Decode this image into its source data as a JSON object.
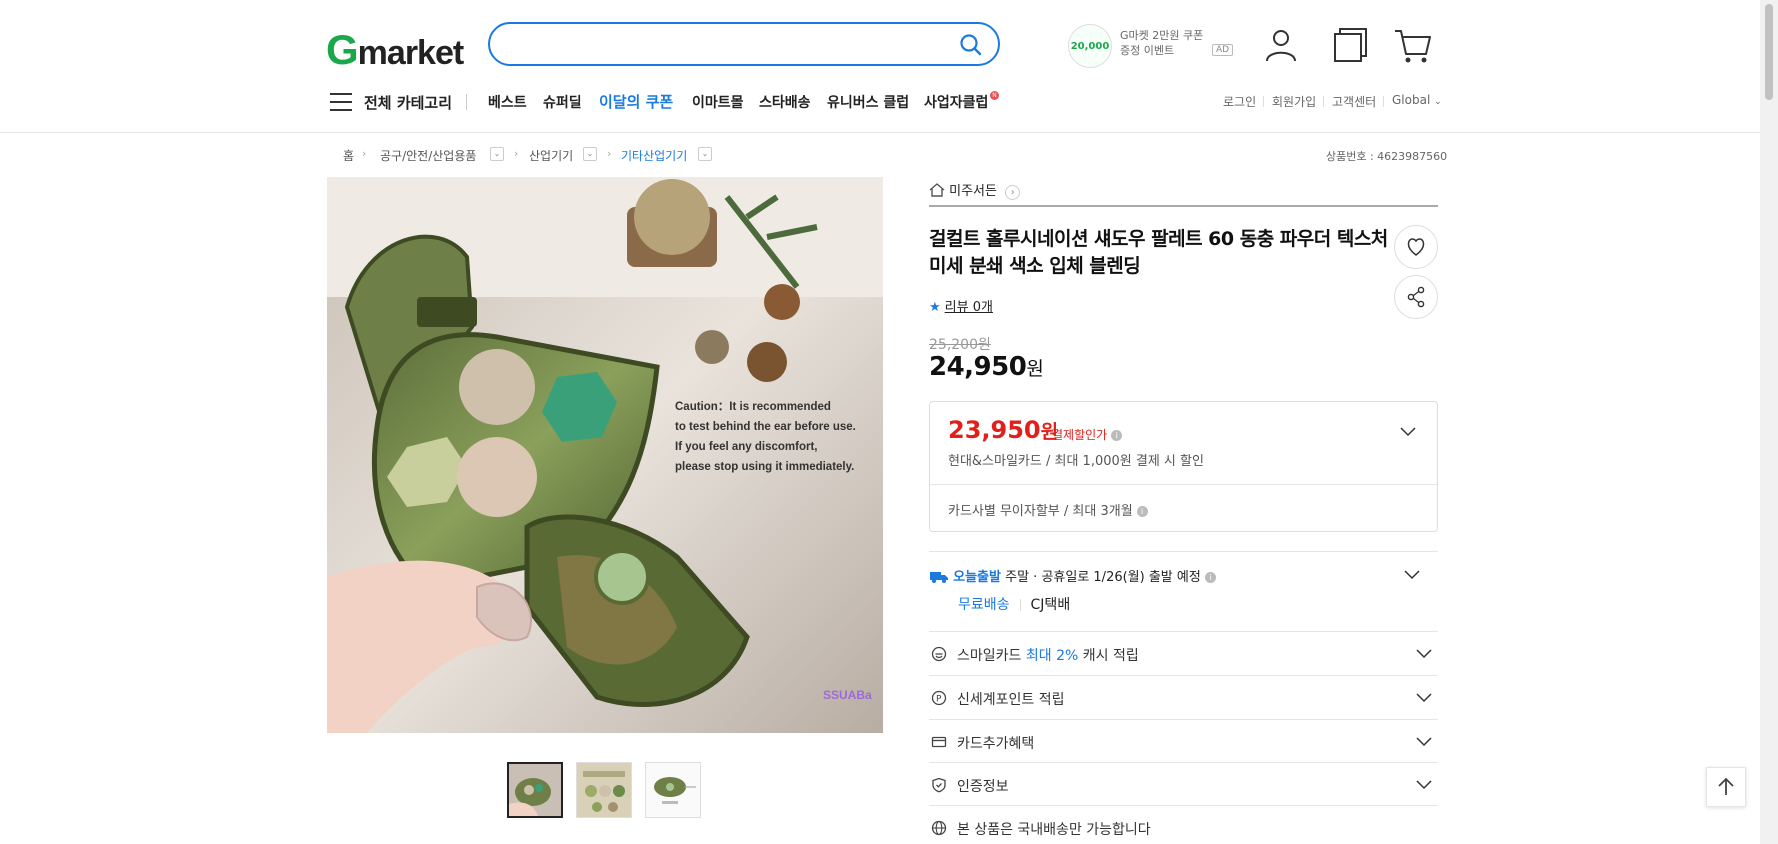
{
  "header": {
    "logo_g": "G",
    "logo_rest": "market",
    "search_placeholder": "",
    "ad": {
      "amount": "20,000",
      "line1": "G마켓 2만원 쿠폰",
      "line2": "증정 이벤트",
      "badge": "AD"
    }
  },
  "nav": {
    "all_categories": "전체 카테고리",
    "items": [
      "베스트",
      "슈퍼딜",
      "이달의 쿠폰",
      "이마트몰",
      "스타배송",
      "유니버스 클럽",
      "사업자클럽"
    ],
    "new_badge": "N",
    "utility": [
      "로그인",
      "회원가입",
      "고객센터",
      "Global"
    ]
  },
  "breadcrumb": {
    "home": "홈",
    "items": [
      "공구/안전/산업용품",
      "산업기기",
      "기타산업기기"
    ],
    "product_no": "상품번호 : 4623987560"
  },
  "product": {
    "seller": "미주서든",
    "title": "걸컬트 홀루시네이션 섀도우 팔레트 60 동충 파우더 텍스처 미세 분쇄 색소 입체 블렌딩",
    "review": "리뷰 0개",
    "original_price": "25,200원",
    "price_num": "24,950",
    "price_unit": "원",
    "image_caption": [
      "Caution：It is recommended",
      "to test behind the ear before use.",
      "If you feel any discomfort,",
      "please stop using it immediately."
    ],
    "image_watermark": "SSUABa"
  },
  "card_box": {
    "price_num": "23,950",
    "price_unit": "원",
    "tag": "결제할인가",
    "desc": "현대&스마일카드 / 최대 1,000원 결제 시 할인",
    "installment": "카드사별 무이자할부 / 최대 3개월"
  },
  "shipping": {
    "today": "오늘출발",
    "schedule": "주말 · 공휴일로 1/26(월) 출발 예정",
    "free": "무료배송",
    "courier": "CJ택배"
  },
  "benefits": {
    "smile_pre": "스마일카드 ",
    "smile_hl": "최대 2%",
    "smile_post": " 캐시 적립",
    "ssg": "신세계포인트 적립",
    "card": "카드추가혜택",
    "cert": "인증정보",
    "domestic": "본 상품은 국내배송만 가능합니다"
  },
  "colors": {
    "accent": "#1a7ae0",
    "brand_green": "#1aa84b",
    "discount": "#e0201a"
  }
}
